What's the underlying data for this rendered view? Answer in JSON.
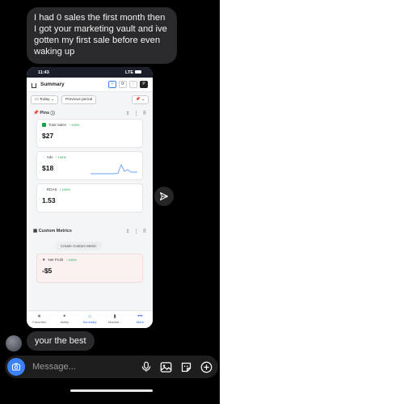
{
  "chat": {
    "incoming_message": "I had 0 sales the first month then I got your marketing vault and ive gotten my first sale before even waking up",
    "reply_message": "your the best",
    "compose_placeholder": "Message..."
  },
  "screenshot": {
    "status_time": "11:43",
    "status_network": "LTE",
    "app_title": "Summary",
    "filter_today": "Today",
    "filter_period": "Previous period",
    "pins_label": "Pins",
    "cards": [
      {
        "label": "Total Sales",
        "change": "↑ 100%",
        "value": "$27"
      },
      {
        "label": "Ads",
        "change": "↑ 100%",
        "value": "$18"
      },
      {
        "label": "ROAS",
        "change": "↑ 100%",
        "value": "1.53"
      }
    ],
    "custom_metrics_label": "Custom Metrics",
    "create_custom_metric": "Create Custom Metric",
    "net_profit": {
      "label": "Net Profit",
      "change": "↑ 100%",
      "value": "-$5"
    },
    "nav": [
      {
        "label": "Favorites",
        "icon": "star-icon"
      },
      {
        "label": "Ability",
        "icon": "sparkle-icon"
      },
      {
        "label": "Summary",
        "icon": "home-icon"
      },
      {
        "label": "Marketi...",
        "icon": "bar-chart-icon"
      },
      {
        "label": "More",
        "icon": "more-icon"
      }
    ],
    "accent_color": "#2563eb",
    "positive_color": "#16a34a"
  }
}
